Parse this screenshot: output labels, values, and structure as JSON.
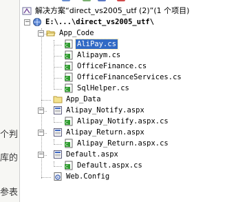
{
  "solution": {
    "title": "解决方案“direct_vs2005_utf (2)”(1 个项目)",
    "project": "E:\\...\\direct_vs2005_utf\\",
    "app_code": {
      "label": "App_Code",
      "files": [
        "AliPay.cs",
        "Alipaym.cs",
        "OfficeFinance.cs",
        "OfficeFinanceServices.cs",
        "SqlHelper.cs"
      ]
    },
    "app_data": "App_Data",
    "pages": [
      {
        "label": "Alipay_Notify.aspx",
        "code": "Alipay_Notify.aspx.cs"
      },
      {
        "label": "Alipay_Return.aspx",
        "code": "Alipay_Return.aspx.cs"
      },
      {
        "label": "Default.aspx",
        "code": "Default.aspx.cs"
      }
    ],
    "web_config": "Web.Config",
    "selected_item": "AliPay.cs"
  },
  "left_pane": {
    "fragments": [
      "个判",
      "库的",
      "参表"
    ]
  },
  "colors": {
    "selection": "#316ac5",
    "folder": "#e8d27a",
    "cs_file": "#2e9b2e"
  }
}
